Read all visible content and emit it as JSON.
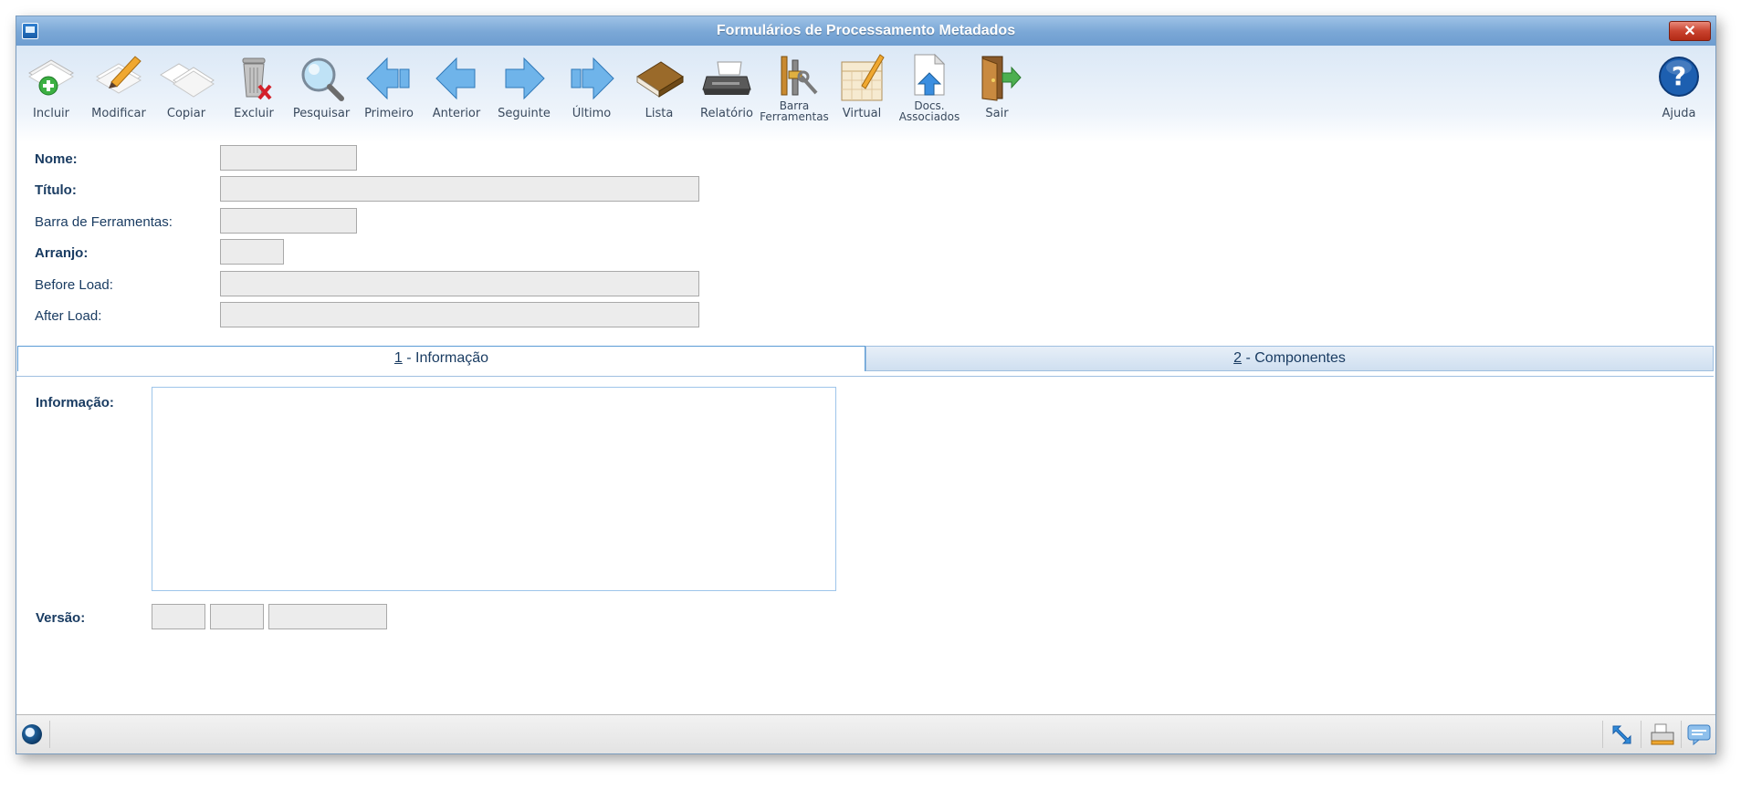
{
  "window": {
    "title": "Formulários de Processamento Metadados",
    "close_label": "✕"
  },
  "toolbar": {
    "items": [
      {
        "label": "Incluir",
        "icon": "add-icon"
      },
      {
        "label": "Modificar",
        "icon": "edit-icon"
      },
      {
        "label": "Copiar",
        "icon": "copy-icon"
      },
      {
        "label": "Excluir",
        "icon": "trash-icon"
      },
      {
        "label": "Pesquisar",
        "icon": "search-icon"
      },
      {
        "label": "Primeiro",
        "icon": "first-arrow-icon"
      },
      {
        "label": "Anterior",
        "icon": "previous-arrow-icon"
      },
      {
        "label": "Seguinte",
        "icon": "next-arrow-icon"
      },
      {
        "label": "Último",
        "icon": "last-arrow-icon"
      },
      {
        "label": "Lista",
        "icon": "book-icon"
      },
      {
        "label": "Relatório",
        "icon": "printer-icon"
      },
      {
        "label": "Barra Ferramentas",
        "icon": "tools-icon",
        "line1": "Barra",
        "line2": "Ferramentas"
      },
      {
        "label": "Virtual",
        "icon": "virtual-icon"
      },
      {
        "label": "Docs. Associados",
        "icon": "docs-upload-icon",
        "line1": "Docs.",
        "line2": "Associados"
      },
      {
        "label": "Sair",
        "icon": "exit-door-icon"
      }
    ],
    "help": {
      "label": "Ajuda",
      "icon": "help-icon"
    }
  },
  "form": {
    "nome_label": "Nome:",
    "titulo_label": "Título:",
    "barra_label": "Barra de Ferramentas:",
    "arranjo_label": "Arranjo:",
    "before_label": "Before Load:",
    "after_label": "After Load:",
    "nome_value": "",
    "titulo_value": "",
    "barra_value": "",
    "arranjo_value": "",
    "before_value": "",
    "after_value": ""
  },
  "tabs": {
    "tab1_key": "1",
    "tab1_rest": " - Informação",
    "tab2_key": "2",
    "tab2_rest": " - Componentes",
    "active": "1"
  },
  "panel": {
    "info_label": "Informação:",
    "info_value": "",
    "versao_label": "Versão:",
    "versao_major": "",
    "versao_minor": "",
    "versao_build": ""
  },
  "colors": {
    "titlebar": "#7aa7d6",
    "label_text": "#1a3c62",
    "close_button": "#c9432f",
    "field_background": "#ececec"
  }
}
